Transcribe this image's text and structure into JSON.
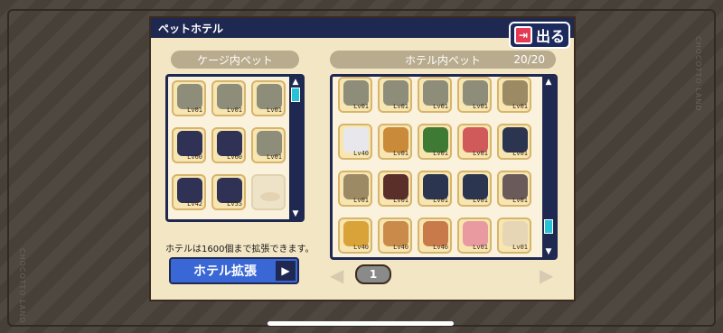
{
  "window": {
    "title": "ペットホテル",
    "exit_label": "出る"
  },
  "cage": {
    "header": "ケージ内ペット",
    "slots": [
      {
        "lv": "Lv01",
        "color": "#8d8d7a"
      },
      {
        "lv": "Lv01",
        "color": "#8d8d7a"
      },
      {
        "lv": "Lv01",
        "color": "#8d8d7a"
      },
      {
        "lv": "Lv60",
        "color": "#2f3155"
      },
      {
        "lv": "Lv60",
        "color": "#2f3155"
      },
      {
        "lv": "Lv01",
        "color": "#8d8d7a"
      },
      {
        "lv": "Lv42",
        "color": "#2f3155"
      },
      {
        "lv": "Lv55",
        "color": "#2f3155"
      },
      {
        "lv": "",
        "color": ""
      }
    ]
  },
  "hotel": {
    "header": "ホテル内ペット",
    "count": "20/20",
    "slots": [
      {
        "lv": "Lv01",
        "color": "#8d8d7a"
      },
      {
        "lv": "Lv01",
        "color": "#8d8d7a"
      },
      {
        "lv": "Lv01",
        "color": "#8d8d7a"
      },
      {
        "lv": "Lv01",
        "color": "#8d8d7a"
      },
      {
        "lv": "Lv01",
        "color": "#9b8a64"
      },
      {
        "lv": "Lv40",
        "color": "#e8e8ec"
      },
      {
        "lv": "Lv01",
        "color": "#c98a3a"
      },
      {
        "lv": "Lv01",
        "color": "#3f7a35"
      },
      {
        "lv": "Lv01",
        "color": "#d05a5a"
      },
      {
        "lv": "Lv01",
        "color": "#2c3550"
      },
      {
        "lv": "Lv01",
        "color": "#9b8a64"
      },
      {
        "lv": "Lv01",
        "color": "#5a2f2a"
      },
      {
        "lv": "Lv01",
        "color": "#2c3550"
      },
      {
        "lv": "Lv01",
        "color": "#2c3550"
      },
      {
        "lv": "Lv01",
        "color": "#6a5a5a"
      },
      {
        "lv": "Lv40",
        "color": "#d9a33a"
      },
      {
        "lv": "Lv40",
        "color": "#c98a4a"
      },
      {
        "lv": "Lv40",
        "color": "#c97a4a"
      },
      {
        "lv": "Lv01",
        "color": "#e89aa0"
      },
      {
        "lv": "Lv01",
        "color": "#e6d6b6"
      }
    ]
  },
  "info_text": "ホテルは1600個まで拡張できます。",
  "expand_button": "ホテル拡張",
  "pagination": {
    "page": "1"
  },
  "watermark": "CHOCOTTO LAND"
}
